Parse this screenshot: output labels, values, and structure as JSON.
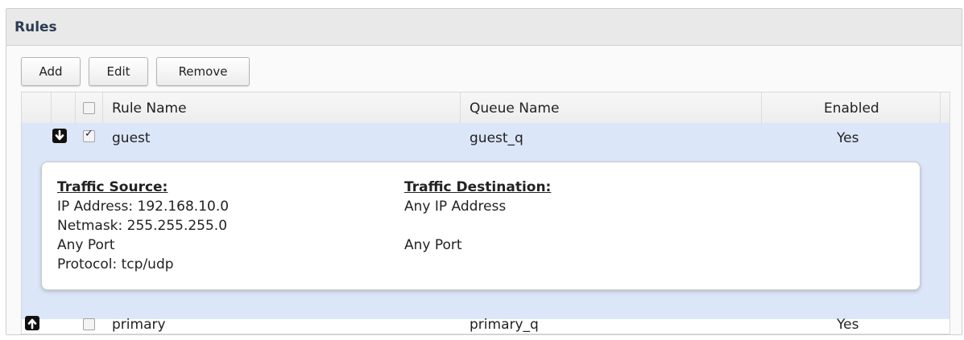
{
  "panel": {
    "title": "Rules"
  },
  "toolbar": {
    "add_label": "Add",
    "edit_label": "Edit",
    "remove_label": "Remove"
  },
  "table": {
    "columns": [
      "Rule Name",
      "Queue Name",
      "Enabled"
    ]
  },
  "rows": [
    {
      "name": "guest",
      "queue": "guest_q",
      "enabled": "Yes",
      "checked": true,
      "arrow": "arrow-down-icon",
      "details": {
        "source_heading": "Traffic Source:",
        "source_lines": [
          "IP Address: 192.168.10.0",
          "Netmask: 255.255.255.0",
          "Any Port",
          "Protocol: tcp/udp"
        ],
        "dest_heading": "Traffic Destination:",
        "dest_lines": [
          "Any IP Address",
          "Any Port"
        ]
      }
    },
    {
      "name": "primary",
      "queue": "primary_q",
      "enabled": "Yes",
      "checked": false,
      "arrow": "arrow-up-icon"
    }
  ],
  "colors": {
    "selected_row": "#dbe6f8",
    "header_bg": "#e9e9e9",
    "title": "#2c3d52"
  }
}
